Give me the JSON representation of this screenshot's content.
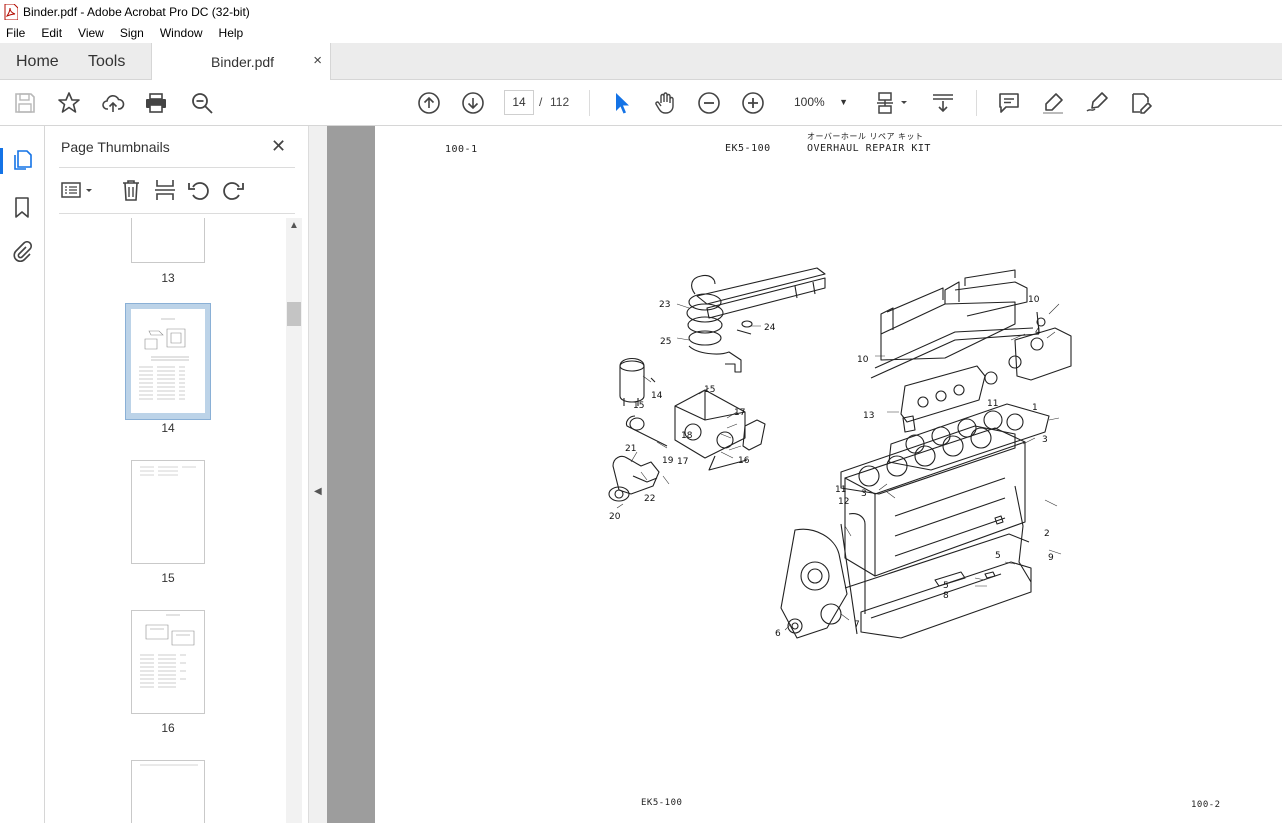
{
  "window": {
    "title": "Binder.pdf - Adobe Acrobat Pro DC (32-bit)"
  },
  "menu": [
    "File",
    "Edit",
    "View",
    "Sign",
    "Window",
    "Help"
  ],
  "tabs": {
    "home": "Home",
    "tools": "Tools",
    "document": "Binder.pdf",
    "close": "×"
  },
  "toolbar": {
    "current_page": "14",
    "separator": "/",
    "total_pages": "112",
    "zoom": "100%"
  },
  "panel": {
    "title": "Page Thumbnails",
    "close": "✕",
    "thumbnails": [
      {
        "label": "13"
      },
      {
        "label": "14",
        "selected": true
      },
      {
        "label": "15"
      },
      {
        "label": "16"
      }
    ]
  },
  "document": {
    "header_left": "100-1",
    "header_model": "EK5-100",
    "header_jp": "オーバーホール リペア キット",
    "header_title": "OVERHAUL REPAIR KIT",
    "footer_left": "EK5-100",
    "footer_right": "100-2",
    "callouts": [
      "1",
      "2",
      "3",
      "3",
      "4",
      "5",
      "5",
      "6",
      "7",
      "8",
      "9",
      "10",
      "10",
      "11",
      "11",
      "12",
      "13",
      "14",
      "15",
      "15",
      "16",
      "17",
      "17",
      "18",
      "19",
      "20",
      "21",
      "22",
      "23",
      "24",
      "25"
    ]
  },
  "colors": {
    "accent": "#1473e6",
    "selection": "#bcd3e8",
    "doc_bg": "#9d9d9d"
  }
}
